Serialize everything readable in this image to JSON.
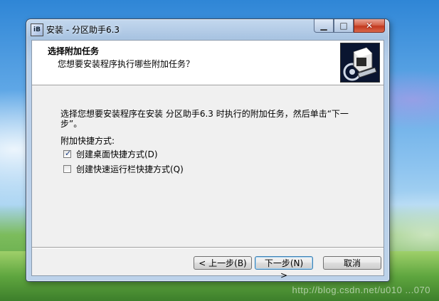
{
  "window": {
    "title": "安装 - 分区助手6.3",
    "app_icon_text": "iB"
  },
  "header": {
    "title": "选择附加任务",
    "subtitle": "您想要安装程序执行哪些附加任务？"
  },
  "body": {
    "instruction": "选择您想要安装程序在安装 分区助手6.3 时执行的附加任务，然后单击“下一步”。",
    "group_label": "附加快捷方式:",
    "options": [
      {
        "label": "创建桌面快捷方式(D)",
        "checked": true
      },
      {
        "label": "创建快速运行栏快捷方式(Q)",
        "checked": false
      }
    ]
  },
  "buttons": {
    "back": "< 上一步(B)",
    "next": "下一步(N) >",
    "cancel": "取消"
  },
  "watermark": "http://blog.csdn.net/u010 ...070"
}
